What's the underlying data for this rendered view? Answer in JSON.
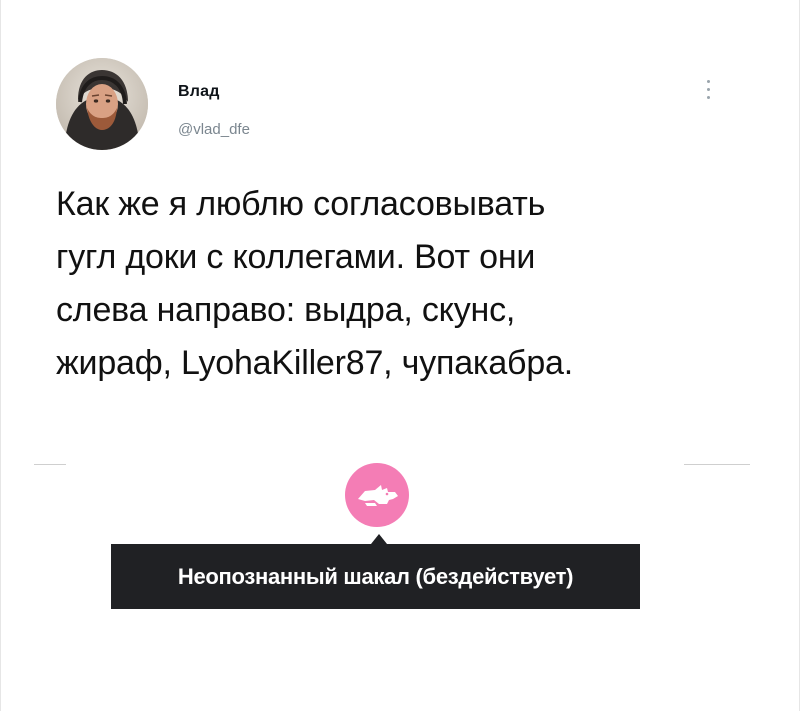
{
  "tweet": {
    "author_name": "Влад",
    "author_handle": "@vlad_dfe",
    "text": "Как же я люблю согласовывать\nгугл доки с коллегами. Вот они\nслева направо: выдра, скунс,\nжираф, LyohaKiller87, чупакабра.",
    "avatar_icon": "user-photo-avatar",
    "more_icon": "more-vertical-icon"
  },
  "collaborator": {
    "icon": "jackal-icon",
    "avatar_color": "#f47db5",
    "tooltip": "Неопознанный шакал (бездействует)"
  },
  "colors": {
    "tooltip_background": "#202124",
    "handle_text": "#7b868f"
  }
}
